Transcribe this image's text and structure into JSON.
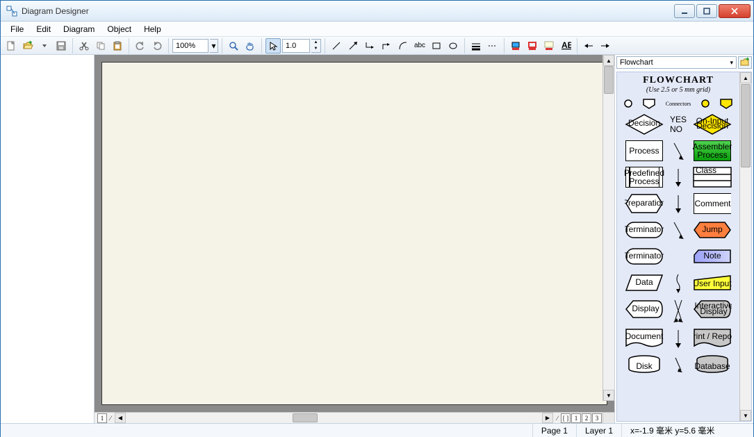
{
  "app": {
    "title": "Diagram Designer"
  },
  "menu": [
    "File",
    "Edit",
    "Diagram",
    "Object",
    "Help"
  ],
  "toolbar": {
    "zoom": "100%",
    "scale": "1.0"
  },
  "palette": {
    "selector": "Flowchart",
    "title": "FLOWCHART",
    "subtitle": "(Use 2.5 or 5 mm grid)",
    "connectors_label": "Connectors",
    "yes": "YES",
    "no": "NO",
    "shapes": {
      "decision": "Decision",
      "on_input_decision": "On-Input Decision",
      "process": "Process",
      "assembler_process": "Assembler Process",
      "predef_process": "Predefined Process",
      "class": "Class",
      "preparation": "Preparation",
      "comment": "Comment",
      "terminator": "Terminator",
      "jump": "Jump",
      "terminator2": "Terminator",
      "note": "Note",
      "data": "Data",
      "user_input": "User Input",
      "display": "Display",
      "interactive_display": "Interactive Display",
      "document": "Document",
      "print_report": "Print / Report",
      "disk": "Disk",
      "database": "Database"
    }
  },
  "pages": {
    "tabs": [
      "1",
      "2",
      "3"
    ],
    "left_marker": "1"
  },
  "status": {
    "page": "Page 1",
    "layer": "Layer 1",
    "coords": "x=-1.9 毫米  y=5.6 毫米"
  }
}
